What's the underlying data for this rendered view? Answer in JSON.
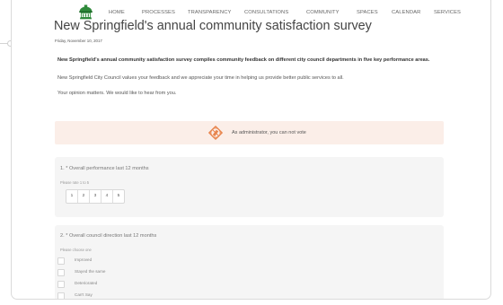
{
  "nav": {
    "items": [
      {
        "label": "HOME"
      },
      {
        "label": "PROCESSES"
      },
      {
        "label": "TRANSPARENCY"
      },
      {
        "label": "CONSULTATIONS"
      },
      {
        "label": "COMMUNITY"
      },
      {
        "label": "SPACES"
      },
      {
        "label": "CALENDAR"
      },
      {
        "label": "SERVICES"
      }
    ]
  },
  "survey": {
    "title": "New Springfield's annual community satisfaction survey",
    "date": "Friday, November 10, 2017",
    "intro_bold": "New Springfield's annual community satisfaction survey compiles community feedback on different city council departments in five key performance areas.",
    "intro_line1": "New Springfield City Council values your feedback and we appreciate your time in helping us provide better public services to all.",
    "intro_line2": "Your opinion matters. We would like to hear from you."
  },
  "notice": {
    "text": "As administrator, you can not vote",
    "icon": "ban-ballot-icon"
  },
  "questions": [
    {
      "label": "1. * Overall performance last 12 months",
      "hint": "Please rate 1 to 5",
      "options": [
        "1",
        "2",
        "3",
        "4",
        "5"
      ]
    },
    {
      "label": "2. * Overall council direction last 12 months",
      "hint": "Please choose one",
      "options": [
        "Improved",
        "Stayed the same",
        "Deteriorated",
        "Can't Say"
      ]
    }
  ],
  "colors": {
    "logo_green": "#2f8a3b",
    "notice_bg": "#fbeee8",
    "notice_icon": "#e8844c",
    "card_bg": "#f5f5f5"
  }
}
